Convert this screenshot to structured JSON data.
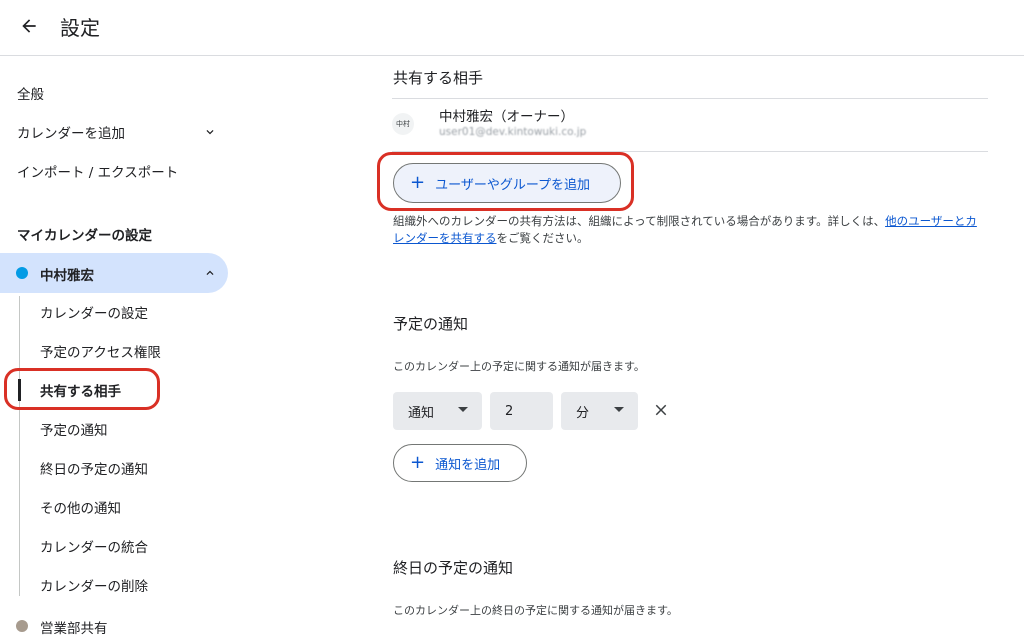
{
  "header": {
    "title": "設定"
  },
  "sidebar": {
    "items": [
      {
        "label": "全般"
      },
      {
        "label": "カレンダーを追加"
      },
      {
        "label": "インポート / エクスポート"
      }
    ],
    "section_title": "マイカレンダーの設定",
    "calendar": {
      "name": "中村雅宏",
      "color": "#039be5",
      "sub_items": [
        {
          "label": "カレンダーの設定"
        },
        {
          "label": "予定のアクセス権限"
        },
        {
          "label": "共有する相手"
        },
        {
          "label": "予定の通知"
        },
        {
          "label": "終日の予定の通知"
        },
        {
          "label": "その他の通知"
        },
        {
          "label": "カレンダーの統合"
        },
        {
          "label": "カレンダーの削除"
        }
      ],
      "active_item": "共有する相手"
    },
    "calendar2": {
      "name": "営業部共有",
      "color": "#a79b8e"
    }
  },
  "main": {
    "share": {
      "title": "共有する相手",
      "member": {
        "avatar": "中村",
        "name": "中村雅宏（オーナー）",
        "email": "user01@dev.kintowuki.co.jp"
      },
      "add_button": "ユーザーやグループを追加",
      "info_prefix": "組織外へのカレンダーの共有方法は、組織によって制限されている場合があります。詳しくは、",
      "info_link": "他のユーザーとカレンダーを共有する",
      "info_suffix": "をご覧ください。"
    },
    "notifications": {
      "title": "予定の通知",
      "description": "このカレンダー上の予定に関する通知が届きます。",
      "type": "通知",
      "amount": "2",
      "unit": "分",
      "add_button": "通知を追加"
    },
    "allday": {
      "title": "終日の予定の通知",
      "description": "このカレンダー上の終日の予定に関する通知が届きます。"
    }
  },
  "colors": {
    "accent": "#0b57d0",
    "selected_bg": "#d3e3fd",
    "highlight": "#d93025"
  }
}
